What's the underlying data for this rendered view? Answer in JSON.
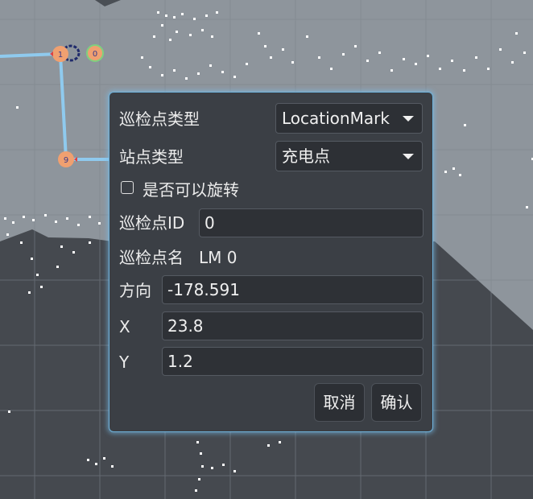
{
  "map": {
    "nodes": [
      {
        "label": "1",
        "color": "#f0a070"
      },
      {
        "label": "0",
        "color": "#f0a070"
      },
      {
        "label": "9",
        "color": "#f0a070"
      }
    ],
    "path_color": "#8fcaee"
  },
  "dialog": {
    "patrol_type_label": "巡检点类型",
    "patrol_type_value": "LocationMark",
    "station_type_label": "站点类型",
    "station_type_value": "充电点",
    "rotatable_label": "是否可以旋转",
    "rotatable_checked": false,
    "patrol_id_label": "巡检点ID",
    "patrol_id_value": "0",
    "patrol_name_label": "巡检点名",
    "patrol_name_value": "LM 0",
    "direction_label": "方向",
    "direction_value": "-178.591",
    "x_label": "X",
    "x_value": "23.8",
    "y_label": "Y",
    "y_value": "1.2",
    "cancel_label": "取消",
    "confirm_label": "确认"
  },
  "colors": {
    "map_background": "#8e959c",
    "dark_region": "#45494f",
    "dialog_bg": "#3b3f45",
    "dialog_border": "#6fb3dc"
  }
}
